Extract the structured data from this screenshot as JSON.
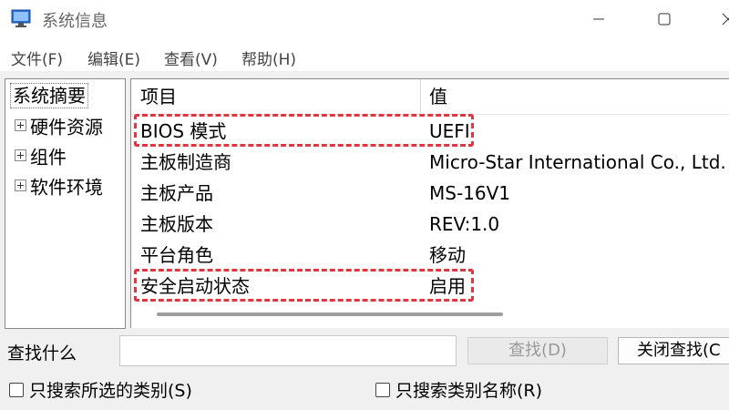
{
  "window": {
    "title": "系统信息",
    "icon": "system-info-icon",
    "controls": [
      "minimize-icon",
      "maximize-icon",
      "close-icon"
    ]
  },
  "menu": {
    "items": [
      {
        "label": "文件(F)"
      },
      {
        "label": "编辑(E)"
      },
      {
        "label": "查看(V)"
      },
      {
        "label": "帮助(H)"
      }
    ]
  },
  "tree": {
    "root": "系统摘要",
    "children": [
      {
        "label": "硬件资源"
      },
      {
        "label": "组件"
      },
      {
        "label": "软件环境"
      }
    ]
  },
  "list": {
    "columns": {
      "item": "项目",
      "value": "值"
    },
    "rows": [
      {
        "item": "BIOS 模式",
        "value": "UEFI",
        "highlighted": true
      },
      {
        "item": "主板制造商",
        "value": "Micro-Star International Co., Ltd."
      },
      {
        "item": "主板产品",
        "value": "MS-16V1"
      },
      {
        "item": "主板版本",
        "value": "REV:1.0"
      },
      {
        "item": "平台角色",
        "value": "移动"
      },
      {
        "item": "安全启动状态",
        "value": "启用",
        "highlighted": true
      }
    ]
  },
  "find": {
    "label": "查找什么",
    "input_value": "",
    "find_button": "查找(D)",
    "close_button": "关闭查找(C"
  },
  "options": {
    "search_selected_category": "只搜索所选的类别(S)",
    "search_category_names": "只搜索类别名称(R)"
  },
  "colors": {
    "highlight": "#e0373f",
    "background": "#f0f0f0"
  }
}
